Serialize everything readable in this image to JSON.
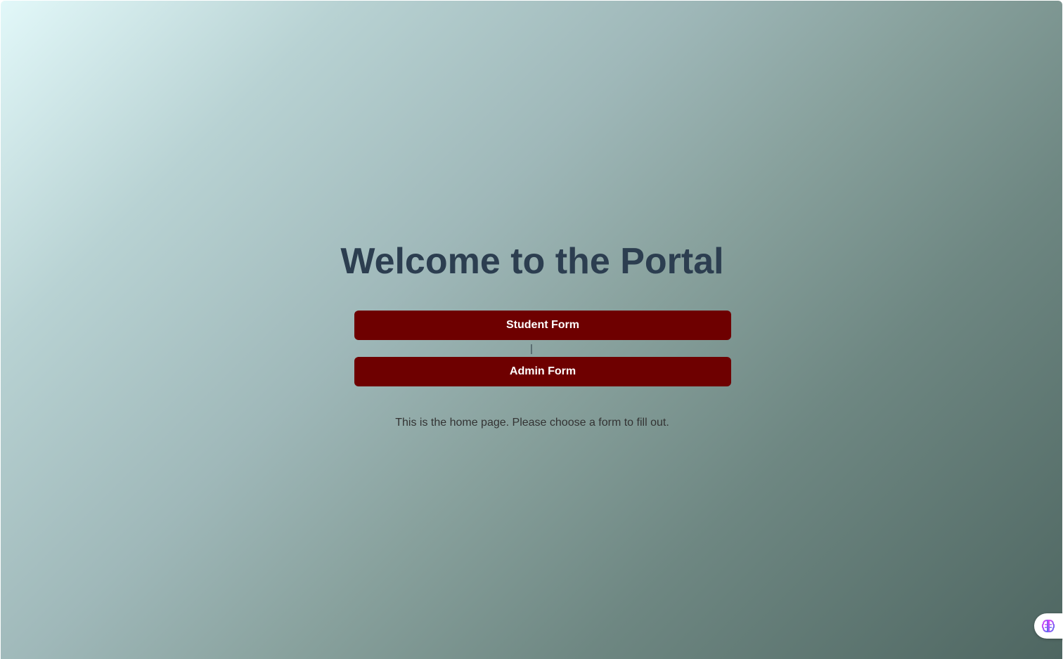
{
  "main": {
    "title": "Welcome to the Portal",
    "buttons": {
      "student_label": "Student Form",
      "admin_label": "Admin Form"
    },
    "separator": "|",
    "description": "This is the home page. Please choose a form to fill out."
  },
  "widget": {
    "icon": "brain-icon"
  },
  "colors": {
    "button_bg": "#6e0000",
    "title": "#2c3e50"
  }
}
